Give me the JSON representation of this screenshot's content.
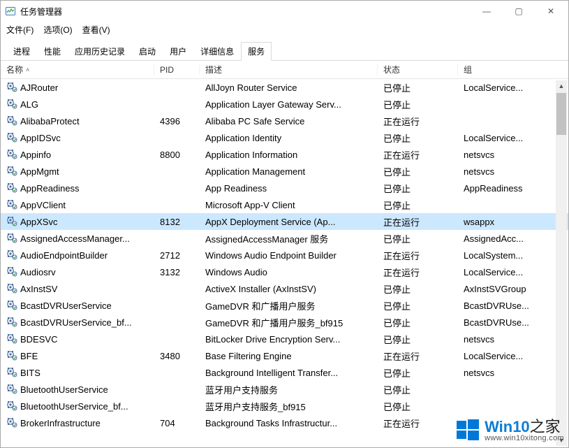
{
  "window": {
    "title": "任务管理器"
  },
  "window_controls": {
    "min": "—",
    "max": "▢",
    "close": "✕"
  },
  "menu": {
    "file": "文件(F)",
    "options": "选项(O)",
    "view": "查看(V)"
  },
  "tabs": {
    "items": [
      "进程",
      "性能",
      "应用历史记录",
      "启动",
      "用户",
      "详细信息",
      "服务"
    ],
    "active_index": 6
  },
  "columns": {
    "name": "名称",
    "pid": "PID",
    "desc": "描述",
    "status": "状态",
    "group": "组"
  },
  "status_labels": {
    "stopped": "已停止",
    "running": "正在运行"
  },
  "services": [
    {
      "name": "AJRouter",
      "pid": "",
      "desc": "AllJoyn Router Service",
      "status": "已停止",
      "group": "LocalService..."
    },
    {
      "name": "ALG",
      "pid": "",
      "desc": "Application Layer Gateway Serv...",
      "status": "已停止",
      "group": ""
    },
    {
      "name": "AlibabaProtect",
      "pid": "4396",
      "desc": "Alibaba PC Safe Service",
      "status": "正在运行",
      "group": ""
    },
    {
      "name": "AppIDSvc",
      "pid": "",
      "desc": "Application Identity",
      "status": "已停止",
      "group": "LocalService..."
    },
    {
      "name": "Appinfo",
      "pid": "8800",
      "desc": "Application Information",
      "status": "正在运行",
      "group": "netsvcs"
    },
    {
      "name": "AppMgmt",
      "pid": "",
      "desc": "Application Management",
      "status": "已停止",
      "group": "netsvcs"
    },
    {
      "name": "AppReadiness",
      "pid": "",
      "desc": "App Readiness",
      "status": "已停止",
      "group": "AppReadiness"
    },
    {
      "name": "AppVClient",
      "pid": "",
      "desc": "Microsoft App-V Client",
      "status": "已停止",
      "group": ""
    },
    {
      "name": "AppXSvc",
      "pid": "8132",
      "desc": "AppX Deployment Service (Ap...",
      "status": "正在运行",
      "group": "wsappx",
      "selected": true
    },
    {
      "name": "AssignedAccessManager...",
      "pid": "",
      "desc": "AssignedAccessManager 服务",
      "status": "已停止",
      "group": "AssignedAcc..."
    },
    {
      "name": "AudioEndpointBuilder",
      "pid": "2712",
      "desc": "Windows Audio Endpoint Builder",
      "status": "正在运行",
      "group": "LocalSystem..."
    },
    {
      "name": "Audiosrv",
      "pid": "3132",
      "desc": "Windows Audio",
      "status": "正在运行",
      "group": "LocalService..."
    },
    {
      "name": "AxInstSV",
      "pid": "",
      "desc": "ActiveX Installer (AxInstSV)",
      "status": "已停止",
      "group": "AxInstSVGroup"
    },
    {
      "name": "BcastDVRUserService",
      "pid": "",
      "desc": "GameDVR 和广播用户服务",
      "status": "已停止",
      "group": "BcastDVRUse..."
    },
    {
      "name": "BcastDVRUserService_bf...",
      "pid": "",
      "desc": "GameDVR 和广播用户服务_bf915",
      "status": "已停止",
      "group": "BcastDVRUse..."
    },
    {
      "name": "BDESVC",
      "pid": "",
      "desc": "BitLocker Drive Encryption Serv...",
      "status": "已停止",
      "group": "netsvcs"
    },
    {
      "name": "BFE",
      "pid": "3480",
      "desc": "Base Filtering Engine",
      "status": "正在运行",
      "group": "LocalService..."
    },
    {
      "name": "BITS",
      "pid": "",
      "desc": "Background Intelligent Transfer...",
      "status": "已停止",
      "group": "netsvcs"
    },
    {
      "name": "BluetoothUserService",
      "pid": "",
      "desc": "蓝牙用户支持服务",
      "status": "已停止",
      "group": ""
    },
    {
      "name": "BluetoothUserService_bf...",
      "pid": "",
      "desc": "蓝牙用户支持服务_bf915",
      "status": "已停止",
      "group": ""
    },
    {
      "name": "BrokerInfrastructure",
      "pid": "704",
      "desc": "Background Tasks Infrastructur...",
      "status": "正在运行",
      "group": ""
    }
  ],
  "watermark": {
    "brand_main": "Win10",
    "brand_suffix": "之家",
    "domain": "www.win10xitong.com"
  }
}
